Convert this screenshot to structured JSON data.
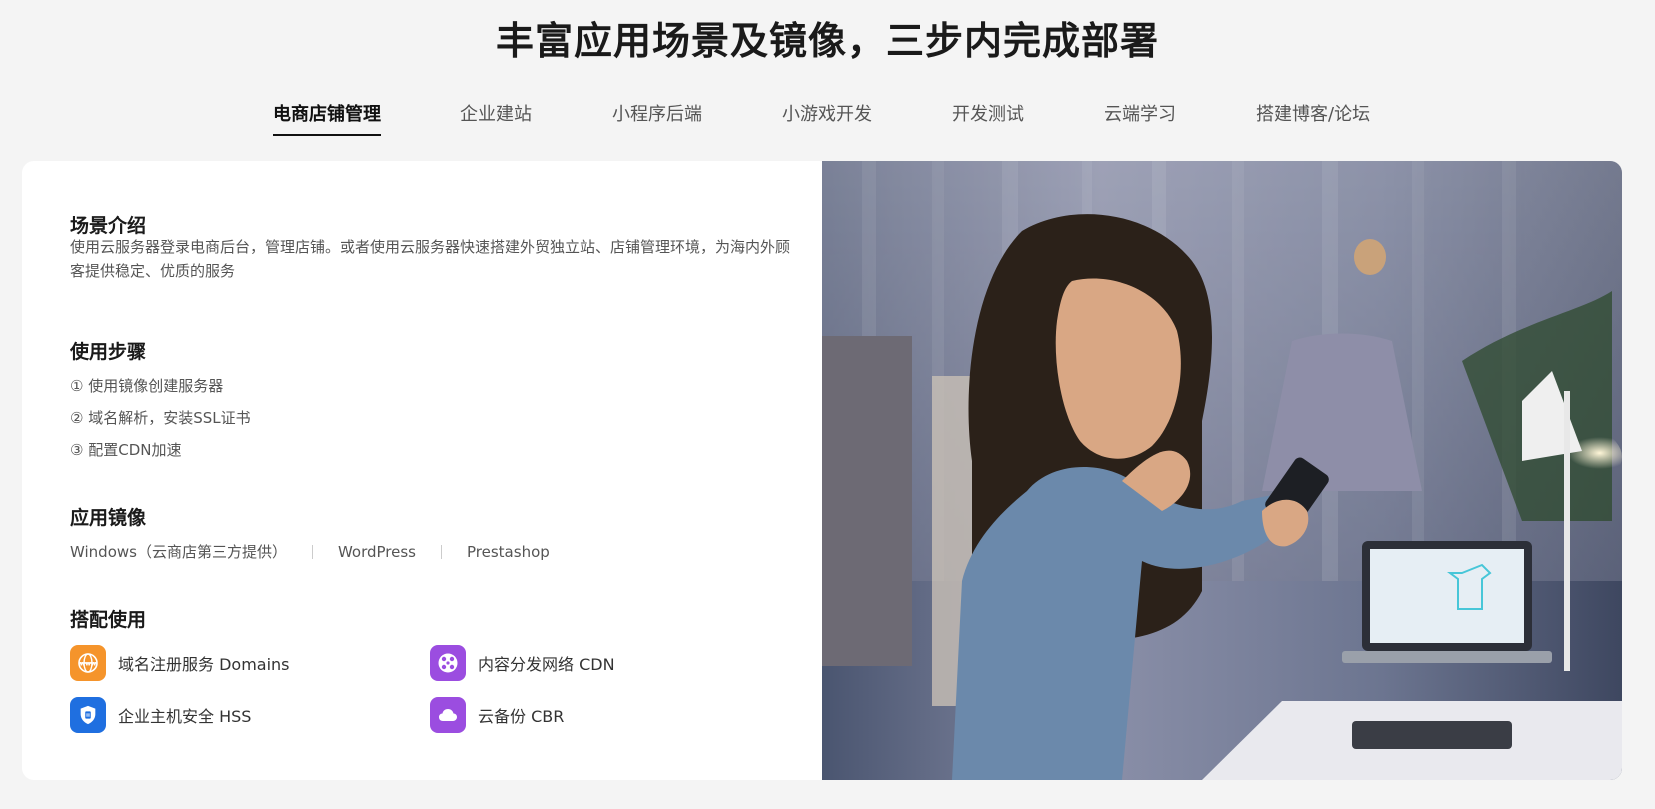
{
  "page": {
    "title": "丰富应用场景及镜像，三步内完成部署"
  },
  "tabs": [
    {
      "label": "电商店铺管理",
      "active": true
    },
    {
      "label": "企业建站"
    },
    {
      "label": "小程序后端"
    },
    {
      "label": "小游戏开发"
    },
    {
      "label": "开发测试"
    },
    {
      "label": "云端学习"
    },
    {
      "label": "搭建博客/论坛"
    }
  ],
  "intro": {
    "heading": "场景介绍",
    "text": "使用云服务器登录电商后台，管理店铺。或者使用云服务器快速搭建外贸独立站、店铺管理环境，为海内外顾客提供稳定、优质的服务"
  },
  "steps": {
    "heading": "使用步骤",
    "items": [
      "① 使用镜像创建服务器",
      "② 域名解析，安装SSL证书",
      "③ 配置CDN加速"
    ]
  },
  "mirrors": {
    "heading": "应用镜像",
    "items": [
      "Windows（云商店第三方提供）",
      "WordPress",
      "Prestashop"
    ]
  },
  "combo": {
    "heading": "搭配使用",
    "items": [
      {
        "label": "域名注册服务 Domains",
        "icon": "globe-www-icon",
        "color": "#f5942b"
      },
      {
        "label": "内容分发网络 CDN",
        "icon": "cdn-network-icon",
        "color": "#9b4de0"
      },
      {
        "label": "企业主机安全 HSS",
        "icon": "shield-icon",
        "color": "#1f6fe0"
      },
      {
        "label": "云备份 CBR",
        "icon": "cloud-backup-icon",
        "color": "#9b4de0"
      }
    ]
  },
  "image": {
    "alt_icon": "photo-woman-phone"
  }
}
